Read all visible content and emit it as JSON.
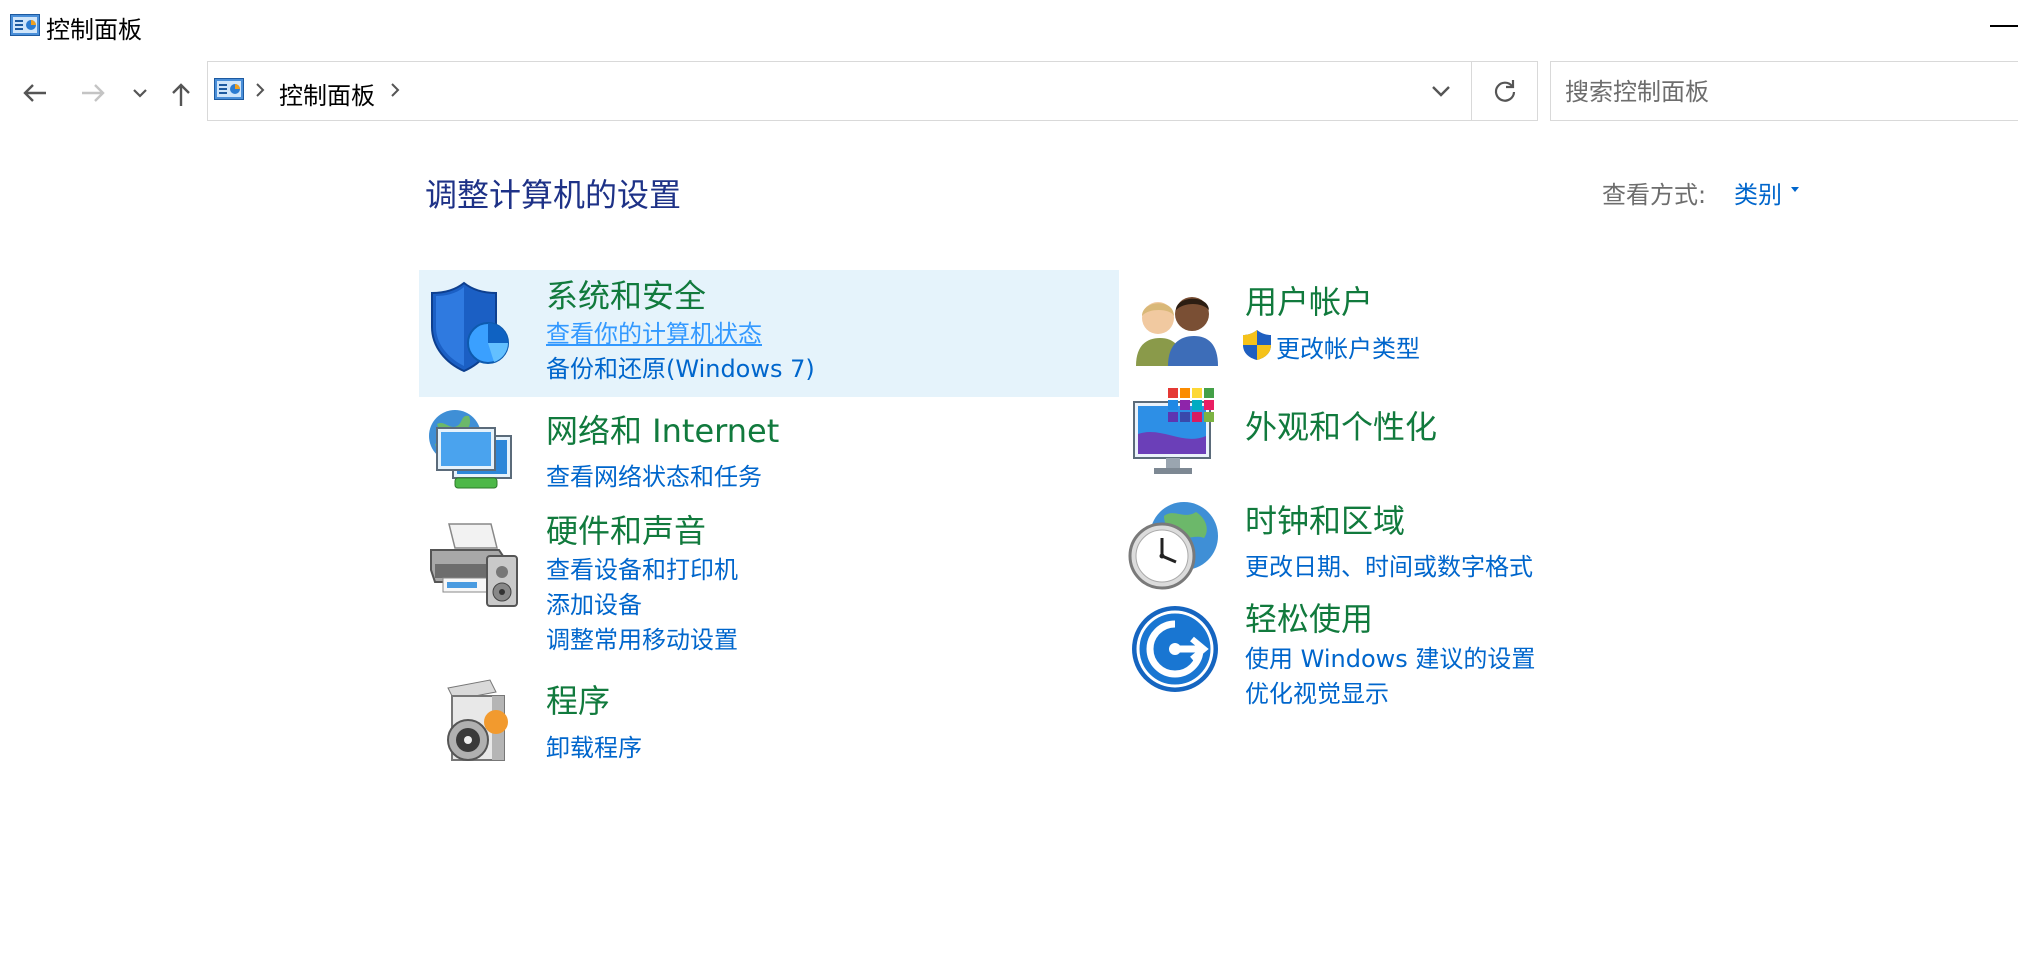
{
  "window": {
    "title": "控制面板"
  },
  "address": {
    "breadcrumb": "控制面板"
  },
  "search": {
    "placeholder": "搜索控制面板",
    "value": ""
  },
  "header": {
    "title": "调整计算机的设置",
    "view_by_label": "查看方式:",
    "view_by_value": "类别"
  },
  "categories": {
    "system_security": {
      "title": "系统和安全",
      "links": [
        "查看你的计算机状态",
        "备份和还原(Windows 7)"
      ],
      "icon": "shield-icon"
    },
    "network": {
      "title": "网络和 Internet",
      "links": [
        "查看网络状态和任务"
      ],
      "icon": "network-icon"
    },
    "hardware": {
      "title": "硬件和声音",
      "links": [
        "查看设备和打印机",
        "添加设备",
        "调整常用移动设置"
      ],
      "icon": "printer-icon"
    },
    "programs": {
      "title": "程序",
      "links": [
        "卸载程序"
      ],
      "icon": "programs-icon"
    },
    "user_accounts": {
      "title": "用户帐户",
      "links": [
        "更改帐户类型"
      ],
      "icon": "users-icon"
    },
    "appearance": {
      "title": "外观和个性化",
      "links": [],
      "icon": "appearance-icon"
    },
    "clock_region": {
      "title": "时钟和区域",
      "links": [
        "更改日期、时间或数字格式"
      ],
      "icon": "clock-globe-icon"
    },
    "ease_of_access": {
      "title": "轻松使用",
      "links": [
        "使用 Windows 建议的设置",
        "优化视觉显示"
      ],
      "icon": "ease-of-access-icon"
    }
  },
  "colors": {
    "category_title": "#117a3d",
    "link": "#0066cc",
    "link_hover": "#3399ff",
    "heading": "#1e3287",
    "highlight": "#e5f3fb"
  }
}
